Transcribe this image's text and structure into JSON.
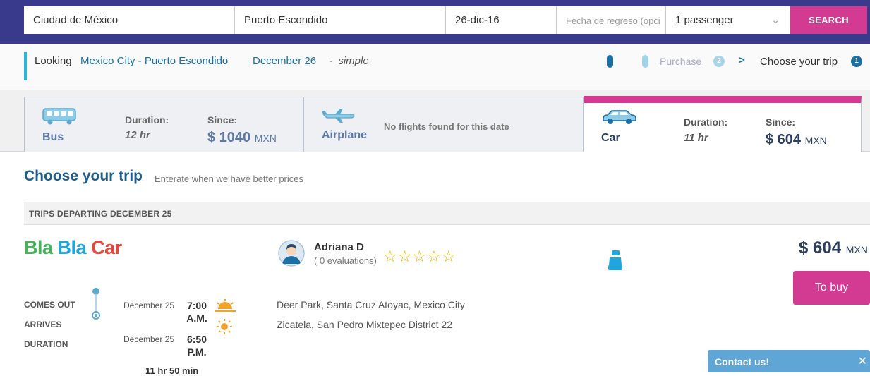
{
  "search": {
    "origin": "Ciudad de México",
    "destination": "Puerto Escondido",
    "departure_date": "26-dic-16",
    "return_placeholder": "Fecha de regreso (opci",
    "passengers": "1 passenger",
    "search_label": "SEARCH"
  },
  "looking": {
    "label": "Looking",
    "route": "Mexico City - Puerto Escondido",
    "date": "December 26",
    "separator": "-",
    "trip_type": "simple"
  },
  "steps": {
    "purchase": "Purchase",
    "purchase_num": "2",
    "arrow": ">",
    "choose": "Choose your trip",
    "choose_num": "1"
  },
  "tabs": {
    "bus": {
      "name": "Bus",
      "duration_label": "Duration:",
      "duration": "12 hr",
      "since_label": "Since:",
      "price": "$ 1040",
      "currency": "MXN"
    },
    "airplane": {
      "name": "Airplane",
      "message": "No flights found for this date"
    },
    "car": {
      "name": "Car",
      "duration_label": "Duration:",
      "duration": "11 hr",
      "since_label": "Since:",
      "price": "$ 604",
      "currency": "MXN"
    }
  },
  "main": {
    "heading": "Choose your trip",
    "notify_link": "Enterate when we have better prices",
    "section_title": "TRIPS DEPARTING DECEMBER 25"
  },
  "trip": {
    "logo": {
      "part1": "Bla",
      "part2": "Bla",
      "part3": "Car"
    },
    "driver_name": "Adriana D",
    "evaluations": "( 0 evaluations)",
    "stars": "☆☆☆☆☆",
    "price": "$ 604",
    "currency": "MXN",
    "buy_label": "To buy",
    "comes_out_label": "COMES OUT",
    "arrives_label": "ARRIVES",
    "duration_label": "DURATION",
    "depart_date": "December 25",
    "depart_time": "7:00 A.M.",
    "arrive_date": "December 25",
    "arrive_time": "6:50 P.M.",
    "duration": "11 hr 50 min",
    "depart_place": "Deer Park, Santa Cruz Atoyac, Mexico City",
    "arrive_place": "Zicatela, San Pedro Mixtepec District 22"
  },
  "contact": {
    "label": "Contact us!"
  },
  "colors": {
    "brand": "#3a3a8c",
    "accent": "#d33b93",
    "link": "#1a6fa5"
  }
}
